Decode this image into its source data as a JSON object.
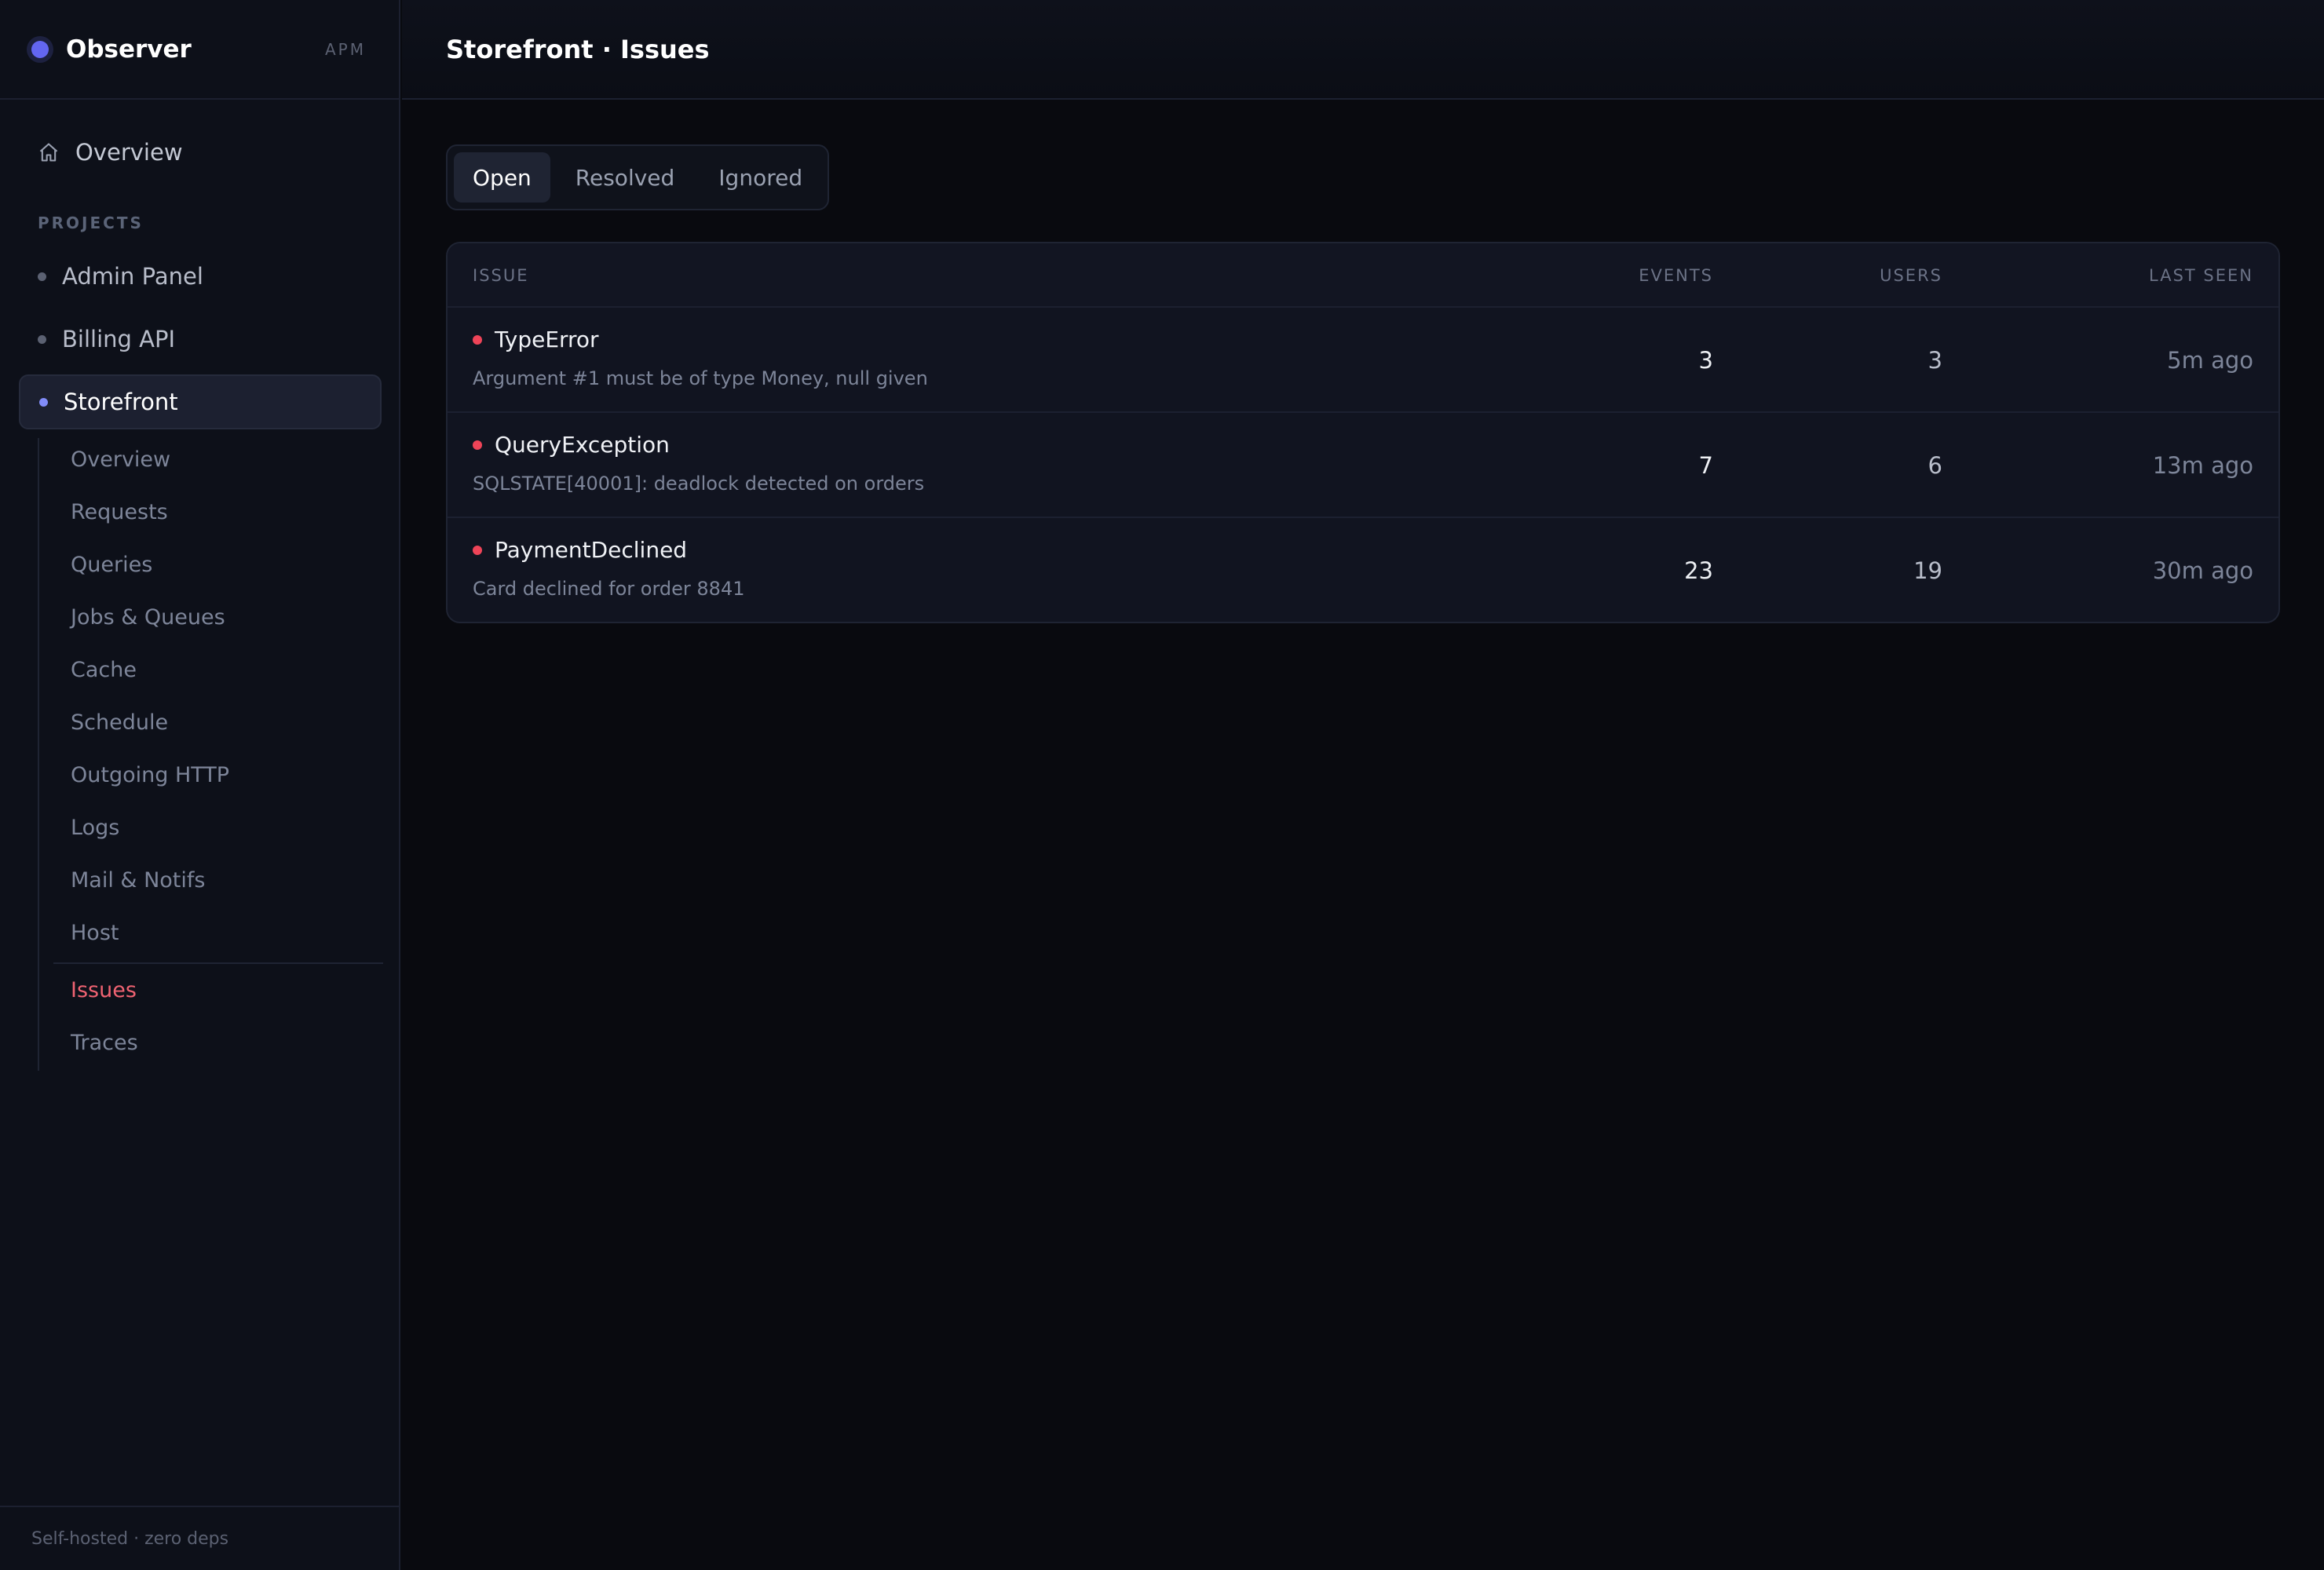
{
  "brand": {
    "name": "Observer",
    "tag": "APM"
  },
  "nav": {
    "overview_label": "Overview",
    "icon": "home-icon"
  },
  "projects": {
    "section_label": "PROJECTS",
    "items": [
      {
        "label": "Admin Panel",
        "active": false
      },
      {
        "label": "Billing API",
        "active": false
      },
      {
        "label": "Storefront",
        "active": true
      }
    ]
  },
  "subnav": {
    "items": [
      {
        "label": "Overview"
      },
      {
        "label": "Requests"
      },
      {
        "label": "Queries"
      },
      {
        "label": "Jobs & Queues"
      },
      {
        "label": "Cache"
      },
      {
        "label": "Schedule"
      },
      {
        "label": "Outgoing HTTP"
      },
      {
        "label": "Logs"
      },
      {
        "label": "Mail & Notifs"
      },
      {
        "label": "Host"
      },
      {
        "label": "Issues",
        "active": true
      },
      {
        "label": "Traces"
      }
    ]
  },
  "footer": {
    "text": "Self-hosted · zero deps"
  },
  "header": {
    "title": "Storefront · Issues"
  },
  "tabs": [
    {
      "label": "Open",
      "active": true
    },
    {
      "label": "Resolved",
      "active": false
    },
    {
      "label": "Ignored",
      "active": false
    }
  ],
  "table": {
    "columns": {
      "issue": "ISSUE",
      "events": "EVENTS",
      "users": "USERS",
      "last_seen": "LAST SEEN"
    },
    "rows": [
      {
        "name": "TypeError",
        "message": "Argument #1 must be of type Money, null given",
        "events": "3",
        "users": "3",
        "last_seen": "5m ago"
      },
      {
        "name": "QueryException",
        "message": "SQLSTATE[40001]: deadlock detected on orders",
        "events": "7",
        "users": "6",
        "last_seen": "13m ago"
      },
      {
        "name": "PaymentDeclined",
        "message": "Card declined for order 8841",
        "events": "23",
        "users": "19",
        "last_seen": "30m ago"
      }
    ]
  },
  "colors": {
    "accent": "#6366f1",
    "error": "#ef4458",
    "active_link": "#f06372",
    "background": "#090a0f",
    "sidebar": "#0d1019"
  }
}
